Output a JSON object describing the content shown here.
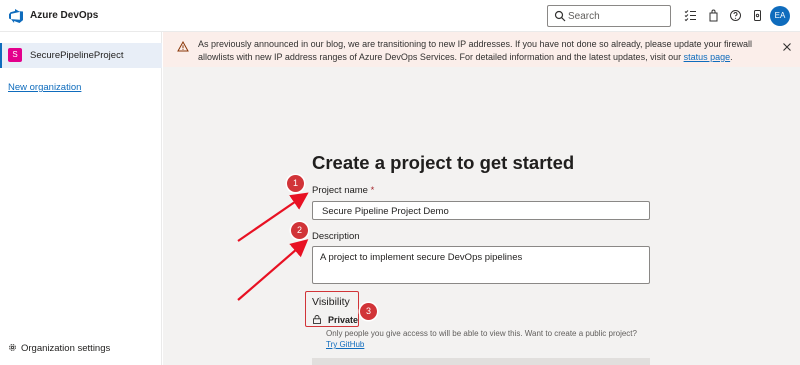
{
  "header": {
    "brand": "Azure DevOps",
    "search_placeholder": "Search",
    "user_initials": "EA",
    "icons": [
      "task-list-icon",
      "shopping-bag-icon",
      "help-icon",
      "settings-icon"
    ]
  },
  "sidebar": {
    "project_initial": "S",
    "project_name": "SecurePipelineProject",
    "new_org_label": "New organization",
    "org_settings_label": "Organization settings"
  },
  "banner": {
    "text": "As previously announced in our blog, we are transitioning to new IP addresses. If you have not done so already, please update your firewall allowlists with new IP address ranges of Azure DevOps Services. For detailed information and the latest updates, visit our ",
    "link_text": "status page",
    "end": "."
  },
  "form": {
    "heading": "Create a project to get started",
    "name_label": "Project name",
    "name_required": "*",
    "name_value": "Secure Pipeline Project Demo",
    "description_label": "Description",
    "description_value": "A project to implement secure DevOps pipelines",
    "visibility_label": "Visibility",
    "visibility_value": "Private",
    "visibility_note": "Only people you give access to will be able to view this. Want to create a public project? ",
    "visibility_link": "Try GitHub"
  },
  "annotations": {
    "step1": "1",
    "step2": "2",
    "step3": "3"
  },
  "colors": {
    "accent": "#0f6cbd",
    "banner_bg": "#fbeeea",
    "annotation_red": "#d13438",
    "project_badge": "#e3008c"
  }
}
